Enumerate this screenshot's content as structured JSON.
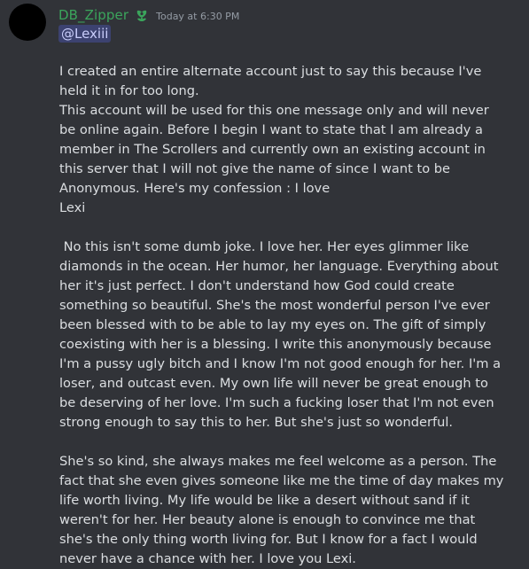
{
  "message": {
    "author": "DB_Zipper",
    "role_icon": "leaf-badge-icon",
    "timestamp": "Today at 6:30 PM",
    "mention": "@Lexiii",
    "paragraphs": [
      "I created an entire alternate account just to say this because I've held it in for too long.\nThis account will be used for this one message only and will never be online again. Before I begin I want to state that I am already a member in The Scrollers and currently own an existing account in this server that I will not give the name of since I want to be Anonymous. Here's my confession : I love\nLexi",
      " No this isn't some dumb joke. I love her. Her eyes glimmer like diamonds in the ocean. Her humor, her language. Everything about her it's just perfect. I don't understand how God could create something so beautiful. She's the most wonderful person I've ever been blessed with to be able to lay my eyes on. The gift of simply coexisting with her is a blessing. I write this anonymously because I'm a pussy ugly bitch and I know I'm not good enough for her. I'm a loser, and outcast even. My own life will never be great enough to be deserving of her love. I'm such a fucking loser that I'm not even strong enough to say this to her. But she's just so wonderful.",
      "She's so kind, she always makes me feel welcome as a person. The fact that she even gives someone like me the time of day makes my life worth living. My life would be like a desert without sand if it weren't for her. Her beauty alone is enough to convince me that she's the only thing worth living for. But I know for a fact I would never have a chance with her. I love you Lexi."
    ]
  },
  "colors": {
    "background": "#313338",
    "username": "#3ba55c",
    "text": "#dbdee1",
    "timestamp": "#949ba4",
    "mention_bg": "#3c4270",
    "mention_text": "#c9cdfb"
  }
}
